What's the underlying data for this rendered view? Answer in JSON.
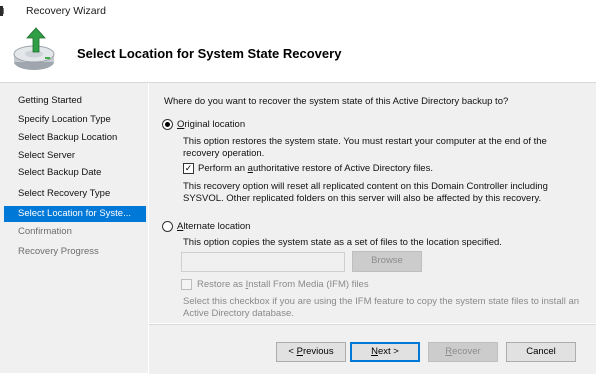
{
  "window": {
    "title": "Recovery Wizard"
  },
  "header": {
    "heading": "Select Location for System State Recovery"
  },
  "sidebar": {
    "items": [
      {
        "label": "Getting Started",
        "state": "normal"
      },
      {
        "label": "Specify Location Type",
        "state": "normal"
      },
      {
        "label": "Select Backup Location",
        "state": "normal"
      },
      {
        "label": "Select Server",
        "state": "normal"
      },
      {
        "label": "Select Backup Date",
        "state": "normal"
      },
      {
        "label": "Select Recovery Type",
        "state": "normal"
      },
      {
        "label": "Select Location for Syste...",
        "state": "selected"
      },
      {
        "label": "Confirmation",
        "state": "disabled"
      },
      {
        "label": "Recovery Progress",
        "state": "disabled"
      }
    ]
  },
  "main": {
    "question": "Where do you want to recover the system state of this Active Directory backup to?",
    "original": {
      "label_prefix": "",
      "label_key": "O",
      "label_rest": "riginal location",
      "selected": true,
      "desc_line1": "This option restores the system state. You must restart your computer at the end of the",
      "desc_line2": "recovery operation.",
      "authoritative": {
        "label_prefix": "Perform an ",
        "label_key": "a",
        "label_rest": "uthoritative restore of Active Directory files.",
        "checked": true,
        "check_glyph": "✓"
      },
      "note_line1": "This recovery option will reset all replicated content on this Domain Controller including",
      "note_line2": "SYSVOL. Other replicated folders on this server will also be affected by this recovery."
    },
    "alternate": {
      "label_prefix": "",
      "label_key": "A",
      "label_rest": "lternate location",
      "selected": false,
      "desc": "This option copies the system state as a set of files to the location specified.",
      "path_value": "",
      "browse_label": "Browse",
      "ifm": {
        "label_prefix": "Restore as ",
        "label_key": "I",
        "label_rest": "nstall From Media (IFM) files",
        "checked": false
      },
      "ifm_note_line1": "Select this checkbox if you are using the IFM feature to copy the system state files to install an",
      "ifm_note_line2": "Active Directory database."
    }
  },
  "footer": {
    "previous": {
      "prefix": "< ",
      "key": "P",
      "rest": "revious"
    },
    "next": {
      "prefix": "",
      "key": "N",
      "rest": "ext >"
    },
    "recover": {
      "prefix": "",
      "key": "R",
      "rest": "ecover"
    },
    "cancel": "Cancel"
  },
  "colors": {
    "accent": "#0078d7",
    "panel": "#f0f0f0",
    "disabled_text": "#8a8a8a"
  }
}
